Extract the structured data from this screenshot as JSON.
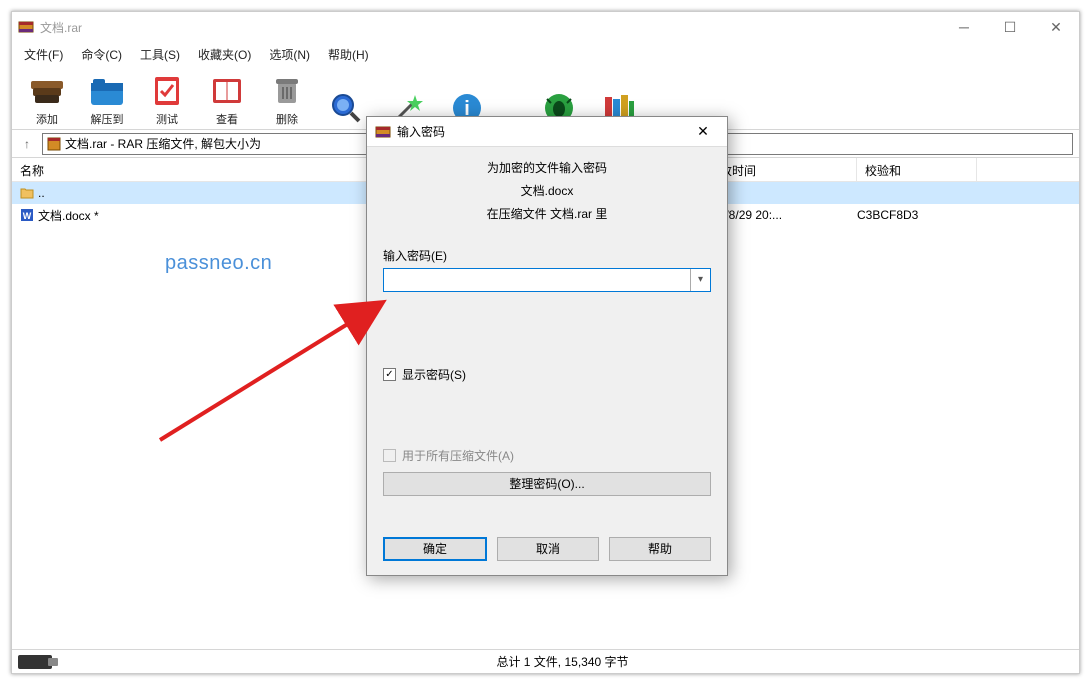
{
  "window": {
    "title": "文档.rar"
  },
  "menu": {
    "file": "文件(F)",
    "command": "命令(C)",
    "tools": "工具(S)",
    "favorites": "收藏夹(O)",
    "options": "选项(N)",
    "help": "帮助(H)"
  },
  "toolbar": {
    "add": "添加",
    "extract": "解压到",
    "test": "测试",
    "view": "查看",
    "delete": "删除"
  },
  "address": {
    "path_text": "文档.rar - RAR 压缩文件, 解包大小为"
  },
  "columns": {
    "name": "名称",
    "date": "改时间",
    "checksum": "校验和"
  },
  "files": {
    "parent": "..",
    "row1_name": "文档.docx *",
    "row1_date": "23/8/29 20:...",
    "row1_check": "C3BCF8D3"
  },
  "status": {
    "text": "总计 1 文件, 15,340 字节"
  },
  "dialog": {
    "title": "输入密码",
    "msg1": "为加密的文件输入密码",
    "msg2": "文档.docx",
    "msg3": "在压缩文件 文档.rar 里",
    "pw_label": "输入密码(E)",
    "show_pw": "显示密码(S)",
    "use_all": "用于所有压缩文件(A)",
    "organize": "整理密码(O)...",
    "ok": "确定",
    "cancel": "取消",
    "help": "帮助"
  },
  "watermark": "passneo.cn"
}
